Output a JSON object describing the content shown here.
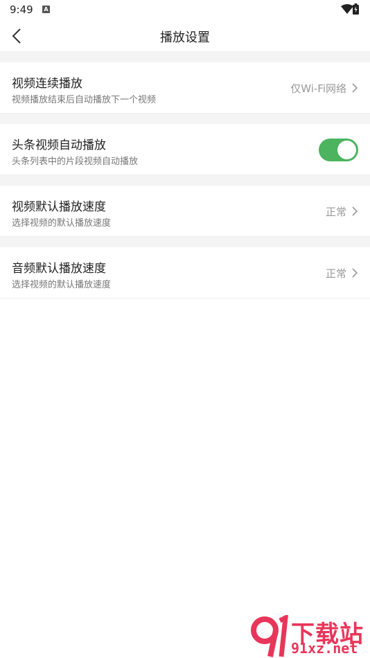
{
  "status_bar": {
    "time": "9:49",
    "notification_icon": "A"
  },
  "header": {
    "title": "播放设置"
  },
  "settings": [
    {
      "title": "视频连续播放",
      "subtitle": "视频播放结束后自动播放下一个视频",
      "value": "仅Wi-Fi网络"
    },
    {
      "title": "头条视频自动播放",
      "subtitle": "头条列表中的片段视频自动播放",
      "toggle": true
    },
    {
      "title": "视频默认播放速度",
      "subtitle": "选择视频的默认播放速度",
      "value": "正常"
    },
    {
      "title": "音频默认播放速度",
      "subtitle": "选择视频的默认播放速度",
      "value": "正常"
    }
  ],
  "watermark": {
    "top": "下载站",
    "bottom": "91xz.net"
  },
  "colors": {
    "toggle_on": "#4cb35f",
    "watermark": "#e8365a",
    "section_gap": "#f4f4f4"
  }
}
